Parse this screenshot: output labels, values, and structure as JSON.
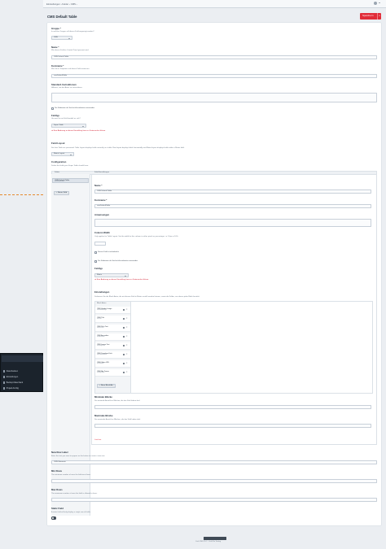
{
  "topbar": {
    "breadcrumb": "Einstellungen  ›  Felder  ›  CMS  ›"
  },
  "page": {
    "title": "CMS Default Table",
    "save_label": "Speichern"
  },
  "fields": {
    "group_label": "Gruppe *",
    "group_ins": "In welcher Gruppe soll dieses Feld angezeigt werden?",
    "group_value": "CMS",
    "name_label": "Name *",
    "name_ins": "Wie dieses Feld im Control Panel genannt wird.",
    "name_value": "CMS Default Table",
    "handle_label": "Kurzname *",
    "handle_ins": "Wie Sie in Templates auf dieses Feld verweisen.",
    "handle_value": "cmsDefaultTable",
    "instructions_label": "Standard-Instruktionen",
    "instructions_ins": "Hilfetext, um den Autor zu unterstützen.",
    "searchable_label": "Die Feldwerte als Suchschlüsselwörter verwenden",
    "fieldtype_label": "Feldtyp",
    "fieldtype_ins": "Um was für ein Feld handelt es sich?",
    "fieldtype_value": "Super Table",
    "fieldtype_warn": "▲ Eine Änderung an dieser Einstellung kann zu Datenverlust führen.",
    "layout_label": "Field Layout",
    "layout_ins": "Set how Table are presented. Table Layout displays fields vertically in a table. Row layout displays fields horizontally and Matrix layout displays fields within a Matrix field.",
    "layout_value": "Matrix Layout",
    "config_label": "Configuration",
    "config_ins": "Define the fields your Super Table should have."
  },
  "config": {
    "tab_fields": "Felder",
    "tab_settings": "Feld-Einstellungen",
    "field_item_title": "CMS Default Table",
    "field_item_handle": "cmsDefaultTable",
    "new_field_btn": "+ Neues Feld",
    "name_label": "Name *",
    "name_value": "CMS Default Table",
    "handle_label": "Kurzname *",
    "handle_value": "cmsDefaultTable",
    "instr_label": "Anweisungen",
    "width_label": "Column Width",
    "width_ins": "Only applies for Table Layout. Set the width for this column in either pixels or percentage. i.e. 10px or 10%.",
    "required_label": "Dieses Feld ist erforderlich",
    "searchable_label": "Die Feldwerte als Suchschlüsselwörter verwenden",
    "fieldtype_label": "Feldtyp",
    "fieldtype_value": "Matrix",
    "fieldtype_warn": "▲ Eine Änderung an dieser Einstellung kann zu Datenverlust führen.",
    "settings_label": "Einstellungen",
    "settings_ins": "Definieren Sie die Block-Arten, die mit diesem Feld in Matrix erstellt werden können, sowie die Felder, aus denen jeder Block besteht.",
    "block_types_header": "Block-Arten",
    "blocks": [
      {
        "title": "CMS Header Image",
        "handle": "cmsHeaderImage"
      },
      {
        "title": "CMS Title",
        "handle": "cmsTitle"
      },
      {
        "title": "CMS Rich Text",
        "handle": "cmsRichText"
      },
      {
        "title": "CMS Accordion",
        "handle": "cmsAccordion"
      },
      {
        "title": "CMS Image Text",
        "handle": "cmsImageText"
      },
      {
        "title": "CMS Download Link",
        "handle": "cmsDownloadLink"
      },
      {
        "title": "CMS Video URL",
        "handle": "cmsVideoUrl"
      },
      {
        "title": "CMS Big Teaser",
        "handle": "cmsBigTeaser"
      }
    ],
    "new_block_btn": "+ Neue Block-Art",
    "min_label": "Minimale Blöcke",
    "min_ins": "Die minimale Anzahl an Blöcken, die das Feld haben darf.",
    "max_label": "Maximale Blöcke",
    "max_ins": "Die maximale Anzahl an Blöcken, die das Feld haben darf.",
    "delete": "Löschen"
  },
  "bottom": {
    "newrow_label": "New Row Label",
    "newrow_ins": "Enter the text you want to appear on the button to create a new row.",
    "newrow_value": "CMS Elemente",
    "minrows_label": "Min Rows",
    "minrows_ins": "The minimum number of rows the field must have.",
    "maxrows_label": "Max Rows",
    "maxrows_ins": "The maximum number of rows the field is allowed to have.",
    "static_label": "Static Field",
    "static_ins": "A static field will only display a single row of fields."
  },
  "sidebar": {
    "items": [
      {
        "label": "Datenbanken"
      },
      {
        "label": "Einstellungen"
      },
      {
        "label": "Backup-Datenbank"
      },
      {
        "label": "Projekt-Konfig"
      }
    ]
  },
  "footer": {
    "text": "Craft CMS 3.5.2  ·  Craft Pro Testing"
  }
}
